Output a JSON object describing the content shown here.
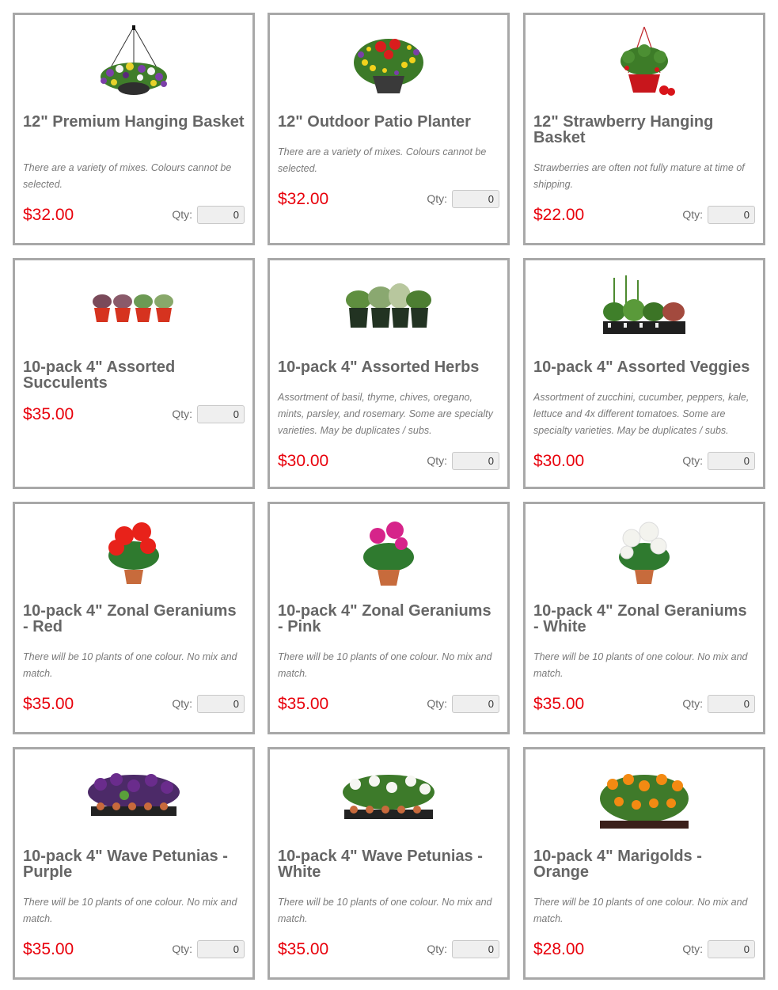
{
  "products": [
    {
      "title": "12\" Premium Hanging Basket",
      "description": "There are a variety of mixes. Colours cannot be selected.",
      "price": "$32.00",
      "qty_label": "Qty:",
      "qty_value": "0",
      "image": "hanging-basket-purple"
    },
    {
      "title": "12\" Outdoor Patio Planter",
      "description": "There are a variety of mixes. Colours cannot be selected.",
      "price": "$32.00",
      "qty_label": "Qty:",
      "qty_value": "0",
      "image": "patio-planter"
    },
    {
      "title": "12\" Strawberry Hanging Basket",
      "description": "Strawberries are often not fully mature at time of shipping.",
      "price": "$22.00",
      "qty_label": "Qty:",
      "qty_value": "0",
      "image": "strawberry-basket"
    },
    {
      "title": "10-pack 4\" Assorted Succulents",
      "description": "",
      "price": "$35.00",
      "qty_label": "Qty:",
      "qty_value": "0",
      "image": "succulents"
    },
    {
      "title": "10-pack 4\" Assorted Herbs",
      "description": "Assortment of basil, thyme, chives, oregano, mints, parsley, and rosemary. Some are specialty varieties. May be duplicates / subs.",
      "price": "$30.00",
      "qty_label": "Qty:",
      "qty_value": "0",
      "image": "herbs"
    },
    {
      "title": "10-pack 4\" Assorted Veggies",
      "description": "Assortment of zucchini, cucumber, peppers, kale, lettuce and 4x different tomatoes. Some are specialty varieties. May be duplicates / subs.",
      "price": "$30.00",
      "qty_label": "Qty:",
      "qty_value": "0",
      "image": "veggies"
    },
    {
      "title": "10-pack 4\" Zonal Geraniums - Red",
      "description": "There will be 10 plants of one colour. No mix and match.",
      "price": "$35.00",
      "qty_label": "Qty:",
      "qty_value": "0",
      "image": "geranium-red"
    },
    {
      "title": "10-pack 4\" Zonal Geraniums - Pink",
      "description": "There will be 10 plants of one colour. No mix and match.",
      "price": "$35.00",
      "qty_label": "Qty:",
      "qty_value": "0",
      "image": "geranium-pink"
    },
    {
      "title": "10-pack 4\" Zonal Geraniums - White",
      "description": "There will be 10 plants of one colour. No mix and match.",
      "price": "$35.00",
      "qty_label": "Qty:",
      "qty_value": "0",
      "image": "geranium-white"
    },
    {
      "title": "10-pack 4\" Wave Petunias - Purple",
      "description": "There will be 10 plants of one colour. No mix and match.",
      "price": "$35.00",
      "qty_label": "Qty:",
      "qty_value": "0",
      "image": "petunia-purple"
    },
    {
      "title": "10-pack 4\" Wave Petunias - White",
      "description": "There will be 10 plants of one colour. No mix and match.",
      "price": "$35.00",
      "qty_label": "Qty:",
      "qty_value": "0",
      "image": "petunia-white"
    },
    {
      "title": "10-pack 4\" Marigolds - Orange",
      "description": "There will be 10 plants of one colour. No mix and match.",
      "price": "$28.00",
      "qty_label": "Qty:",
      "qty_value": "0",
      "image": "marigold-orange"
    }
  ],
  "colors": {
    "price": "#e8000b",
    "title": "#666666",
    "border": "#a8a8a8"
  }
}
